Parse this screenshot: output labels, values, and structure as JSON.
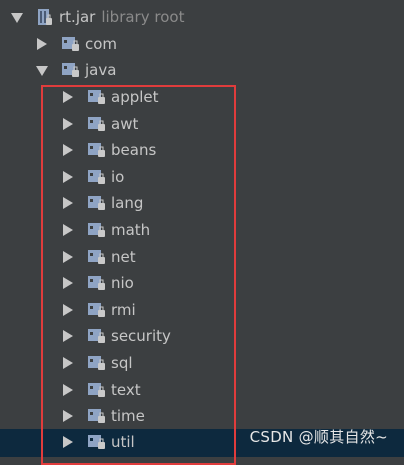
{
  "root": {
    "name": "rt.jar",
    "hint": "library root"
  },
  "nodes": [
    "com",
    "java"
  ],
  "children": [
    "applet",
    "awt",
    "beans",
    "io",
    "lang",
    "math",
    "net",
    "nio",
    "rmi",
    "security",
    "sql",
    "text",
    "time",
    "util"
  ],
  "selected": "util",
  "colors": {
    "background": "#3c3f41",
    "selection": "#0d293e",
    "highlight_box": "#e03c3c"
  },
  "icons": {
    "archive": "jar-archive-icon",
    "package": "package-folder-icon",
    "expanded": "arrow-down-icon",
    "collapsed": "arrow-right-icon"
  },
  "watermark": "CSDN @顺其自然~"
}
